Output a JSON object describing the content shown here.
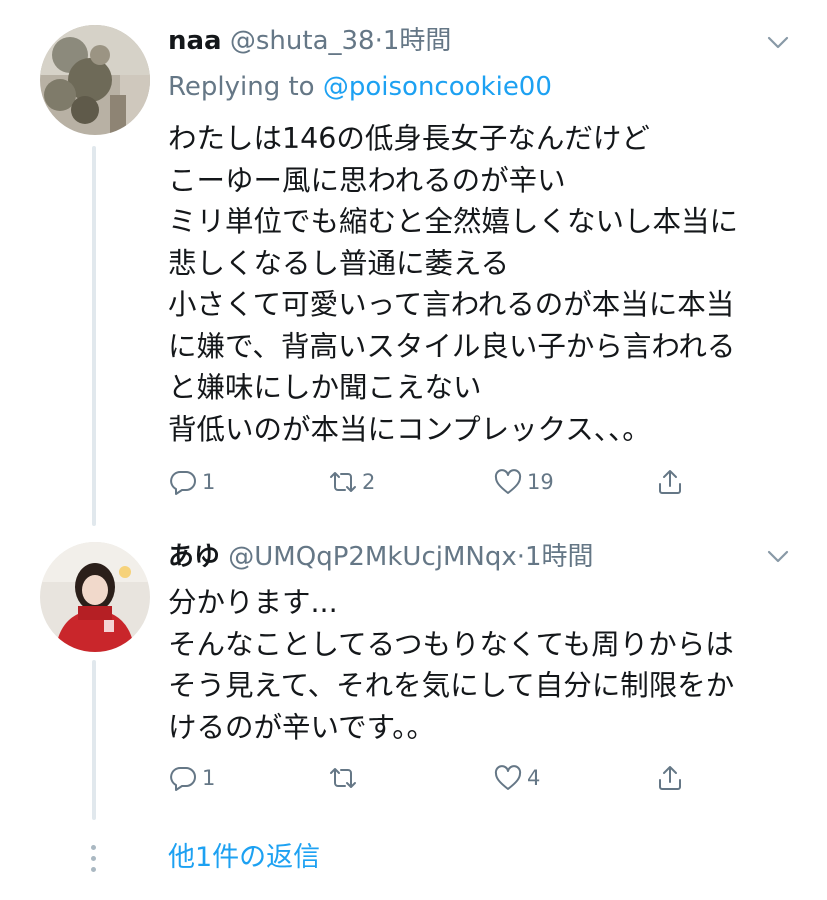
{
  "tweets": [
    {
      "name": "naa",
      "handle": "@shuta_38",
      "separator": "·",
      "time": "1時間",
      "replying_prefix": "Replying to",
      "replying_to": "@poisoncookie00",
      "lines": [
        "わたしは146の低身長女子なんだけど",
        "こーゆー風に思われるのが辛い",
        "ミリ単位でも縮むと全然嬉しくないし本当に",
        "悲しくなるし普通に萎える",
        "小さくて可愛いって言われるのが本当に本当",
        "に嫌で、背高いスタイル良い子から言われる",
        "と嫌味にしか聞こえない",
        "背低いのが本当にコンプレックス、、。"
      ],
      "replies": "1",
      "retweets": "2",
      "likes": "19"
    },
    {
      "name": "あゆ",
      "handle": "@UMQqP2MkUcjMNqx",
      "separator": "·",
      "time": "1時間",
      "lines": [
        "分かります...",
        "そんなことしてるつもりなくても周りからは",
        "そう見えて、それを気にして自分に制限をか",
        "けるのが辛いです。。"
      ],
      "replies": "1",
      "retweets": "",
      "likes": "4"
    }
  ],
  "more_replies": "他1件の返信",
  "colors": {
    "text": "#14171a",
    "secondary": "#657786",
    "link": "#1da1f2",
    "thread_line": "#e1e8ed"
  },
  "icons": [
    "chevron-down-icon",
    "reply-icon",
    "retweet-icon",
    "like-icon",
    "share-icon"
  ]
}
